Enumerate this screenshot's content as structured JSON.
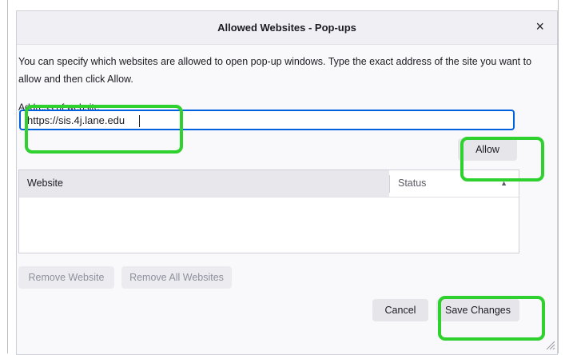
{
  "dialog": {
    "title": "Allowed Websites - Pop-ups",
    "close_glyph": "×",
    "description": "You can specify which websites are allowed to open pop-up windows. Type the exact address of the site you want to allow and then click Allow.",
    "address_label": "Address of website",
    "address_value": "https://sis.4j.lane.edu",
    "allow_label": "Allow",
    "table": {
      "columns": [
        "Website",
        "Status"
      ],
      "sort_indicator": "▲",
      "rows": []
    },
    "remove_website_label": "Remove Website",
    "remove_all_label": "Remove All Websites",
    "cancel_label": "Cancel",
    "save_label": "Save Changes"
  },
  "colors": {
    "highlight": "#2ed12e",
    "focus_ring": "#0060df",
    "button_bg": "#e6e6ea"
  },
  "icons": {
    "close": "close-icon",
    "sort": "sort-ascending-icon",
    "resize": "resize-grip-icon"
  }
}
